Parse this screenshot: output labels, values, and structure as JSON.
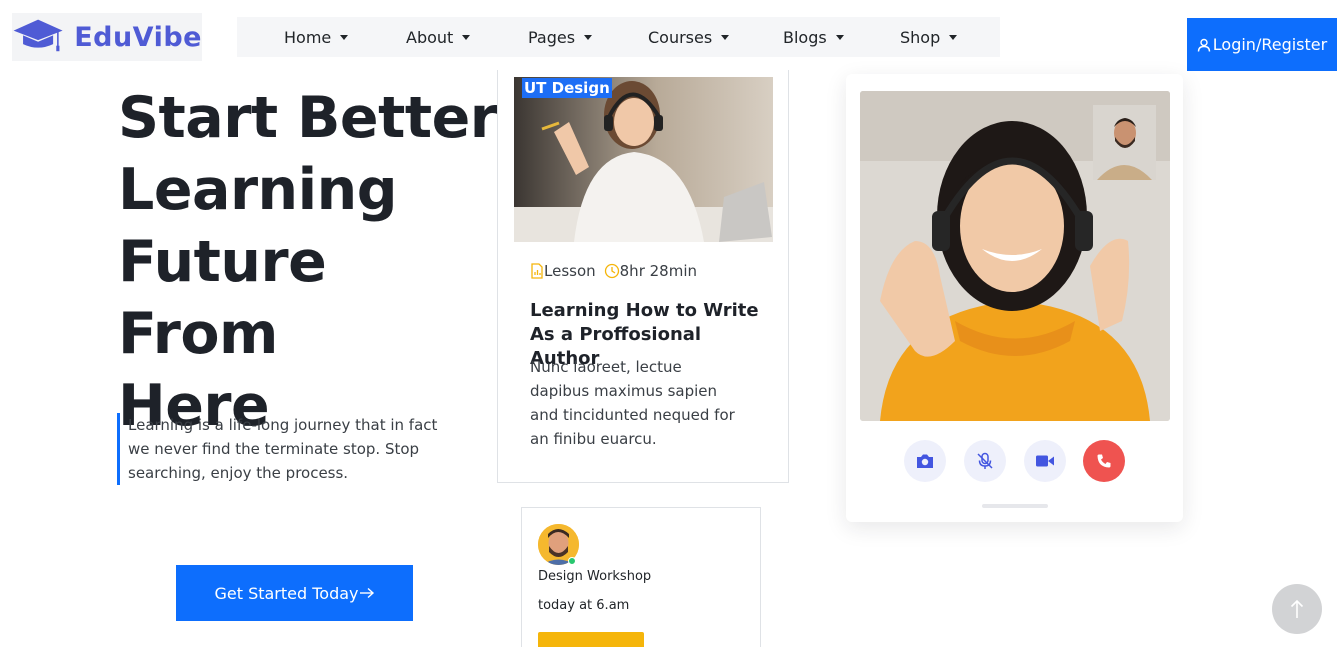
{
  "brand": {
    "name": "EduVibe",
    "accent": "#0d6efd",
    "logo_color": "#4f5bd5"
  },
  "nav": {
    "items": [
      {
        "label": "Home"
      },
      {
        "label": "About"
      },
      {
        "label": "Pages"
      },
      {
        "label": "Courses"
      },
      {
        "label": "Blogs"
      },
      {
        "label": "Shop"
      }
    ],
    "login_label": "Login/Register",
    "login_icon": "user-icon"
  },
  "hero": {
    "title_lines": [
      "Start Better",
      "Learning",
      "Future From",
      "Here"
    ],
    "quote": "Learning is a life-long journey that in fact we never find the terminate stop. Stop searching, enjoy the process.",
    "cta_label": "Get Started Today",
    "cta_icon": "arrow-right-icon"
  },
  "course_card": {
    "badge": "UT Design",
    "lesson_label": "Lesson",
    "duration": "8hr 28min",
    "title": "Learning How to Write As a Proffosional Author",
    "description": "Nunc laoreet, lectue dapibus maximus sapien and tincidunted nequed for an finibu euarcu."
  },
  "workshop_card": {
    "title": "Design Workshop",
    "time": "today at 6.am"
  },
  "video_call": {
    "controls": [
      {
        "icon": "camera-icon"
      },
      {
        "icon": "mic-off-icon"
      },
      {
        "icon": "video-icon"
      },
      {
        "icon": "phone-icon",
        "color": "#ef5350"
      }
    ]
  },
  "scroll_top": {
    "icon": "arrow-up-icon"
  }
}
